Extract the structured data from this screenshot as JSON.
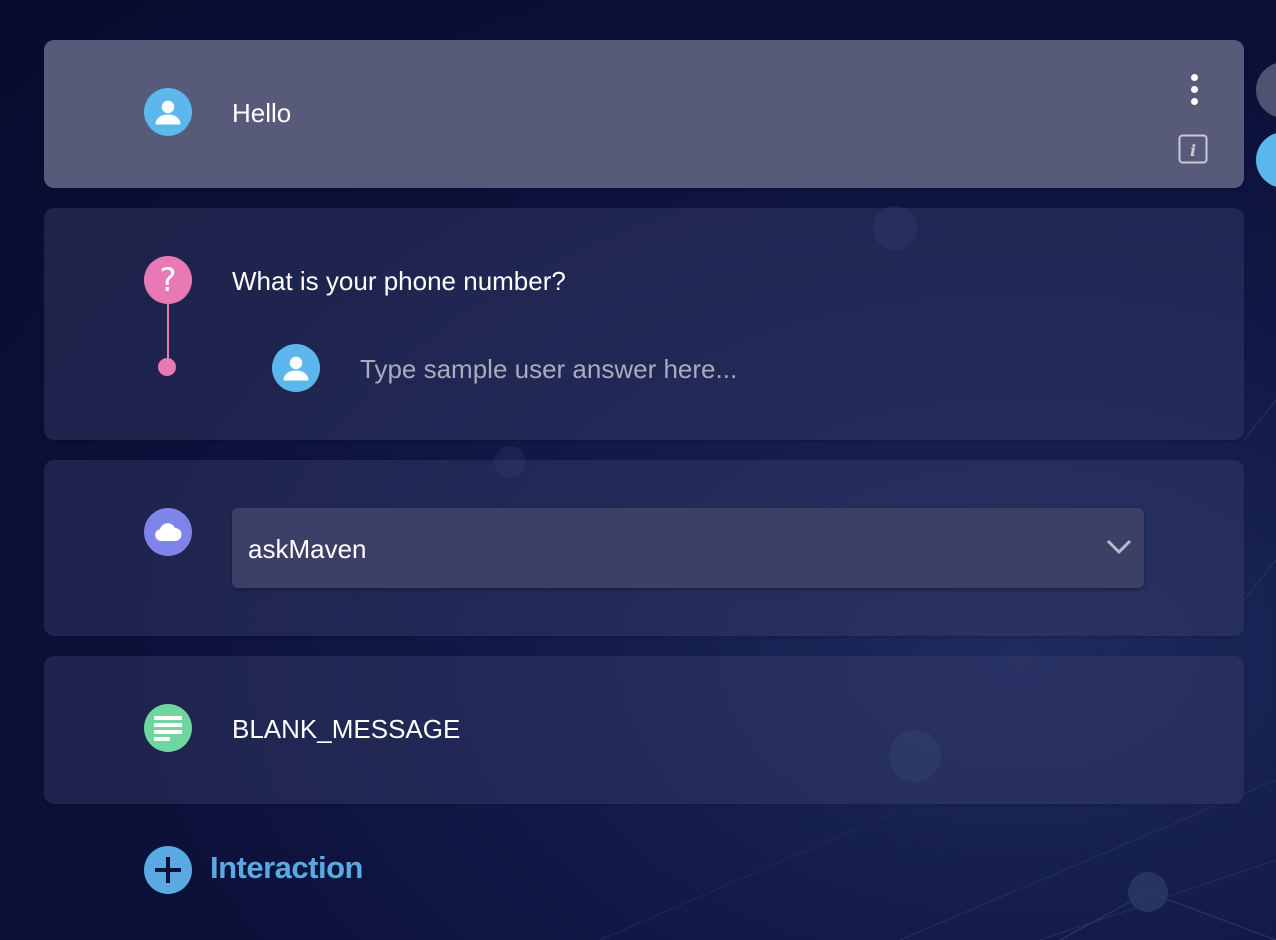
{
  "cards": {
    "user_message": {
      "text": "Hello",
      "icon": "user-icon",
      "color": "#5cb8ec"
    },
    "question": {
      "text": "What is your phone number?",
      "icon": "question-icon",
      "color": "#e879b5",
      "answer_placeholder": "Type sample user answer here...",
      "answer_icon": "user-icon"
    },
    "integration": {
      "icon": "cloud-icon",
      "color": "#7f84e8",
      "selected": "askMaven"
    },
    "text_message": {
      "text": "BLANK_MESSAGE",
      "icon": "text-lines-icon",
      "color": "#6fd6a0"
    }
  },
  "add_interaction": {
    "label": "Interaction",
    "icon": "plus-icon",
    "color": "#5aa9e3"
  },
  "colors": {
    "active_card": "#575a78",
    "background": "#0b1038"
  }
}
